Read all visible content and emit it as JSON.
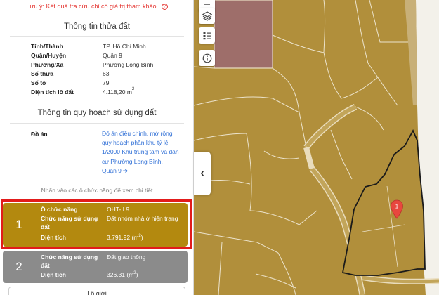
{
  "notice": "Lưu ý: Kết quả tra cứu chỉ có giá trị tham khảo.",
  "land_info": {
    "title": "Thông tin thửa đất",
    "rows": [
      {
        "label": "Tỉnh/Thành",
        "value": "TP. Hồ Chí Minh"
      },
      {
        "label": "Quận/Huyện",
        "value": "Quận 9"
      },
      {
        "label": "Phường/Xã",
        "value": "Phường Long Bình"
      },
      {
        "label": "Số thửa",
        "value": "63"
      },
      {
        "label": "Số tờ",
        "value": "79"
      },
      {
        "label": "Diện tích lô đất",
        "value": "4.118,20 m",
        "unit_sup": "2"
      }
    ]
  },
  "planning": {
    "title": "Thông tin quy hoạch sử dụng đất",
    "do_an_label": "Đồ án",
    "do_an_value": "Đồ án điều chỉnh, mở rộng quy hoạch phân khu tỷ lệ 1/2000 Khu trung tâm và dân cư Phường Long Bình, Quận 9",
    "hint": "Nhấn vào các ô chức năng để xem chi tiết"
  },
  "cells": [
    {
      "number": "1",
      "o_chuc_nang_label": "Ô chức năng",
      "o_chuc_nang_value": "OHT-II.9",
      "chuc_nang_label": "Chức năng sử dụng đất",
      "chuc_nang_value": "Đất nhóm nhà ở hiện trạng",
      "dien_tich_label": "Diện tích",
      "dien_tich_value": "3.791,92 (m",
      "dien_tich_sup": "2",
      "dien_tich_close": ")",
      "color": "#b3890f"
    },
    {
      "number": "2",
      "chuc_nang_label": "Chức năng sử dụng đất",
      "chuc_nang_value": "Đất giao thông",
      "dien_tich_label": "Diện tích",
      "dien_tich_value": "326,31 (m",
      "dien_tich_sup": "2",
      "dien_tich_close": ")",
      "color": "#8b8b8b"
    }
  ],
  "more_button": "Lô giới",
  "map": {
    "pin_label": "1",
    "land_color": "#b18f3b",
    "residential_pink": "#9e6e6a",
    "road_color": "#c2a55a"
  }
}
